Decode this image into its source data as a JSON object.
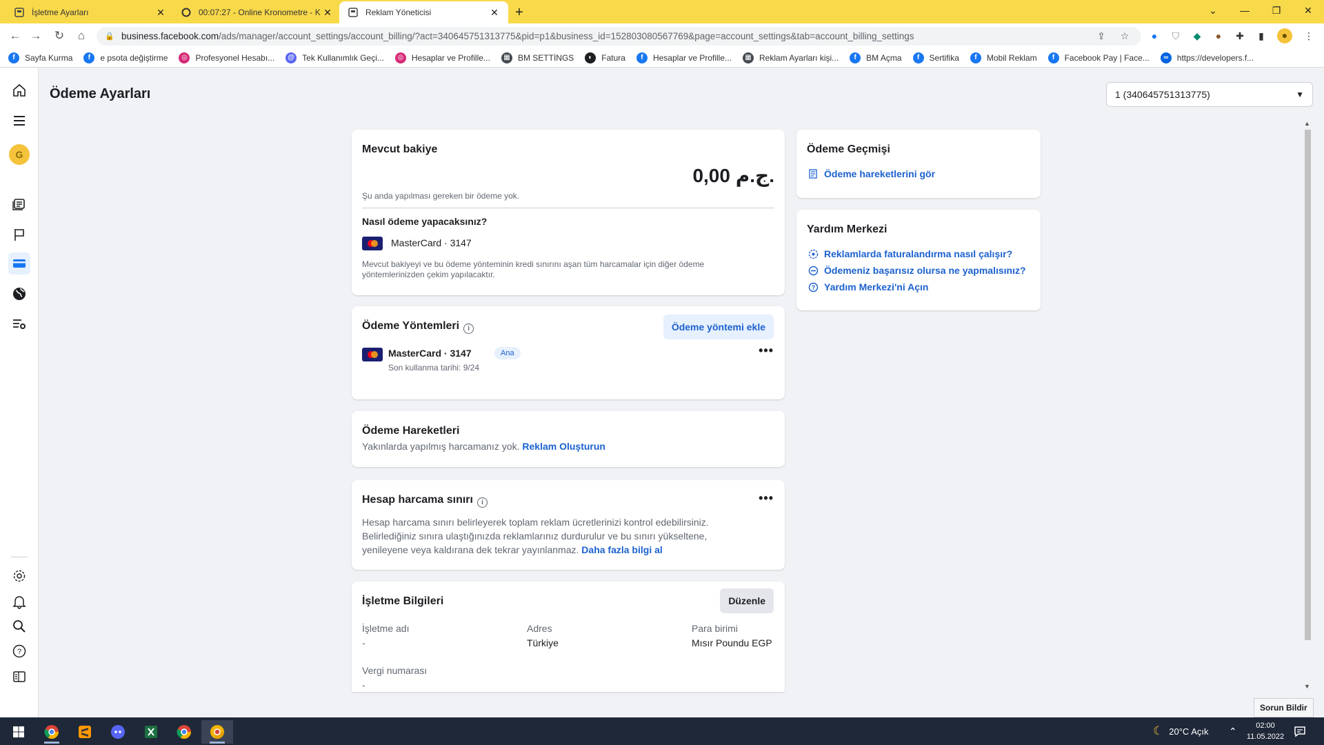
{
  "browser": {
    "tabs": [
      {
        "title": "İşletme Ayarları",
        "icon": "business-page-icon",
        "active": false
      },
      {
        "title": "00:07:27 - Online Kronometre - K",
        "icon": "stopwatch-icon",
        "active": false
      },
      {
        "title": "Reklam Yöneticisi",
        "icon": "ads-manager-icon",
        "active": true
      }
    ],
    "url_host": "business.facebook.com",
    "url_path": "/ads/manager/account_settings/account_billing/?act=340645751313775&pid=p1&business_id=152803080567769&page=account_settings&tab=account_billing_settings",
    "bookmarks": [
      {
        "label": "Sayfa Kurma",
        "color": "#1877f2",
        "glyph": "f"
      },
      {
        "label": "e psota değiştirme",
        "color": "#1877f2",
        "glyph": "f"
      },
      {
        "label": "Profesyonel Hesabı...",
        "color": "#d62976",
        "glyph": "◎"
      },
      {
        "label": "Tek Kullanımlık Geçi...",
        "color": "#5865f2",
        "glyph": "@"
      },
      {
        "label": "Hesaplar ve Profille...",
        "color": "#d62976",
        "glyph": "◎"
      },
      {
        "label": "BM SETTİNGS",
        "color": "#444950",
        "glyph": "▦"
      },
      {
        "label": "Fatura",
        "color": "#1c1e21",
        "glyph": "◐"
      },
      {
        "label": "Hesaplar ve Profille...",
        "color": "#1877f2",
        "glyph": "f"
      },
      {
        "label": "Reklam Ayarları kişi...",
        "color": "#444950",
        "glyph": "▦"
      },
      {
        "label": "BM Açma",
        "color": "#1877f2",
        "glyph": "f"
      },
      {
        "label": "Sertifika",
        "color": "#1877f2",
        "glyph": "f"
      },
      {
        "label": "Mobil Reklam",
        "color": "#1877f2",
        "glyph": "f"
      },
      {
        "label": "Facebook Pay | Face...",
        "color": "#1877f2",
        "glyph": "f"
      },
      {
        "label": "https://developers.f...",
        "color": "#0064e0",
        "glyph": "∞"
      }
    ]
  },
  "nav": {
    "avatar_letter": "G"
  },
  "header": {
    "title": "Ödeme Ayarları",
    "account_selector": "1 (340645751313775)"
  },
  "balance": {
    "title": "Mevcut bakiye",
    "amount": "0,00 ج.م.",
    "status": "Şu anda yapılması gereken bir ödeme yok.",
    "how_title": "Nasıl ödeme yapacaksınız?",
    "card": "MasterCard · 3147",
    "note": "Mevcut bakiyeyi ve bu ödeme yönteminin kredi sınırını aşan tüm harcamalar için diğer ödeme yöntemlerinizden çekim yapılacaktır."
  },
  "methods": {
    "title": "Ödeme Yöntemleri",
    "add_button": "Ödeme yöntemi ekle",
    "card": "MasterCard · 3147",
    "badge": "Ana",
    "expiry": "Son kullanma tarihi: 9/24"
  },
  "transactions": {
    "title": "Ödeme Hareketleri",
    "text": "Yakınlarda yapılmış harcamanız yok.",
    "link": "Reklam Oluşturun"
  },
  "limit": {
    "title": "Hesap harcama sınırı",
    "line1": "Hesap harcama sınırı belirleyerek toplam reklam ücretlerinizi kontrol edebilirsiniz.",
    "line2": "Belirlediğiniz sınıra ulaştığınızda reklamlarınız durdurulur ve bu sınırı yükseltene,",
    "line3": "yenileyene veya kaldırana dek tekrar yayınlanmaz.",
    "link": "Daha fazla bilgi al"
  },
  "business": {
    "title": "İşletme Bilgileri",
    "edit_button": "Düzenle",
    "name_label": "İşletme adı",
    "name_value": "-",
    "address_label": "Adres",
    "address_value": "Türkiye",
    "currency_label": "Para birimi",
    "currency_value": "Mısır Poundu EGP",
    "tax_label": "Vergi numarası",
    "tax_value": "-"
  },
  "history": {
    "title": "Ödeme Geçmişi",
    "link": "Ödeme hareketlerini gör"
  },
  "help": {
    "title": "Yardım Merkezi",
    "links": [
      "Reklamlarda faturalandırma nasıl çalışır?",
      "Ödemeniz başarısız olursa ne yapmalısınız?",
      "Yardım Merkezi'ni Açın"
    ]
  },
  "report_button": "Sorun Bildir",
  "taskbar": {
    "weather": "20°C  Açık",
    "time": "02:00",
    "date": "11.05.2022"
  },
  "colors": {
    "tab_strip": "#f8d94a",
    "link_blue": "#1b61cf",
    "facebook_blue": "#1877f2",
    "page_bg": "#f0f2f5",
    "taskbar": "#1f2838"
  }
}
